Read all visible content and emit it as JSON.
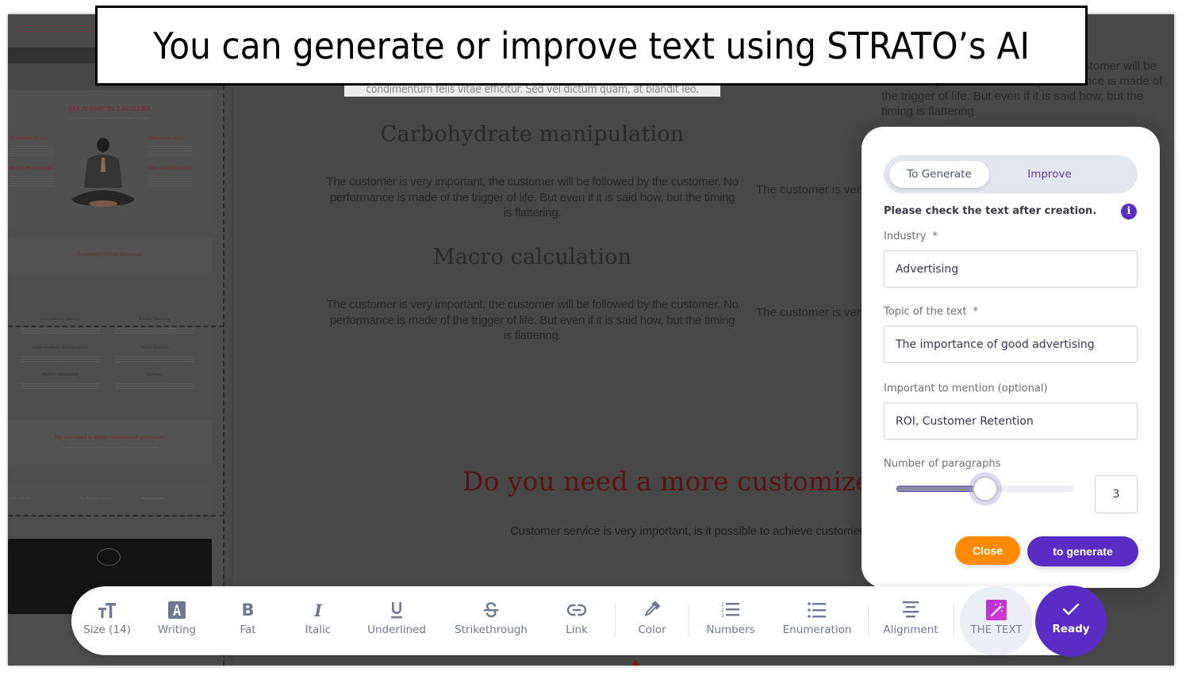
{
  "banner": {
    "caption": "You can generate or improve text using STRATO’s AI"
  },
  "sidebar_preview": {
    "hero_title": "MY NAME IS LAEGERE",
    "hero_subtitle": "The customer is very important, the customer will be followed by the customer.",
    "side_headings": [
      "EUISMOD NULLA",
      "RUTRUM'S DRESS",
      "PRESENT DIAM",
      "THE ROLL OF LIFE"
    ],
    "faq_title": "frequently asked Questions",
    "grid_headings": [
      "Intermittent fasting",
      "Kardio-Training",
      "Carbohydrate manipulation",
      "Schaf-Routine",
      "Macro calculation",
      "Fat loss"
    ],
    "program_title": "Do you need a more customised program?",
    "program_subtitle": "Customer service is very important, is it possible to achieve customer satisfaction? Kontakt",
    "contact_items": [
      "0234 5234 503",
      "Old Street Ave. London",
      "info@gmail.com"
    ]
  },
  "canvas": {
    "selected_line": "condimentum felis vitae efficitur. Sed vel dictum quam, at blandit leo.",
    "top_right_text": "The customer is very important, the customer will be followed by the customer. No performance is made of the trigger of life. But even if it is said how, but the timing is flattering.",
    "sections": [
      {
        "heading": "Carbohydrate manipulation",
        "body": "The customer is very important, the customer will be followed by the customer. No performance is made of the trigger of life. But even if it is said how, but the timing is flattering."
      },
      {
        "heading": "Macro calculation",
        "body": "The customer is very important, the customer will be followed by the customer. No performance is made of the trigger of life. But even if it is said how, but the timing is flattering."
      }
    ],
    "right_column_text": "The customer is very important, the customer will be followed by the customer. No performance",
    "cta_heading": "Do you need a more customized program?",
    "cta_body": "Customer service is very important, is it possible to achieve customer satisfaction?"
  },
  "ai_panel": {
    "tabs": [
      {
        "label": "To Generate",
        "active": true
      },
      {
        "label": "Improve",
        "active": false
      }
    ],
    "notice": "Please check the text after creation.",
    "info_icon": "i",
    "fields": {
      "industry": {
        "label": "Industry",
        "required_mark": "*",
        "value": "Advertising"
      },
      "topic": {
        "label": "Topic of the text",
        "required_mark": "*",
        "value": "The importance of good advertising"
      },
      "mention": {
        "label": "Important to mention (optional)",
        "value": "ROI, Customer Retention"
      }
    },
    "paragraphs": {
      "label": "Number of paragraphs",
      "value": "3",
      "slider_fraction": 0.5
    },
    "close_label": "Close",
    "generate_label": "to generate",
    "colors": {
      "accent": "#5b2cc4",
      "close": "#ff8a00"
    }
  },
  "toolbar": {
    "items": [
      {
        "label": "Size (14)",
        "icon": "text-size-icon"
      },
      {
        "label": "Writing",
        "icon": "font-icon"
      },
      {
        "label": "Fat",
        "icon": "bold-icon"
      },
      {
        "label": "Italic",
        "icon": "italic-icon"
      },
      {
        "label": "Underlined",
        "icon": "underline-icon"
      },
      {
        "label": "Strikethrough",
        "icon": "strikethrough-icon"
      },
      {
        "label": "Link",
        "icon": "link-icon"
      },
      {
        "label": "Color",
        "icon": "eyedropper-icon"
      },
      {
        "label": "Numbers",
        "icon": "numbered-list-icon"
      },
      {
        "label": "Enumeration",
        "icon": "bullet-list-icon"
      },
      {
        "label": "Alignment",
        "icon": "align-center-icon"
      },
      {
        "label": "THE TEXT",
        "icon": "ai-magic-wand-icon"
      },
      {
        "label": "Ready",
        "icon": "checkmark-icon"
      }
    ]
  }
}
